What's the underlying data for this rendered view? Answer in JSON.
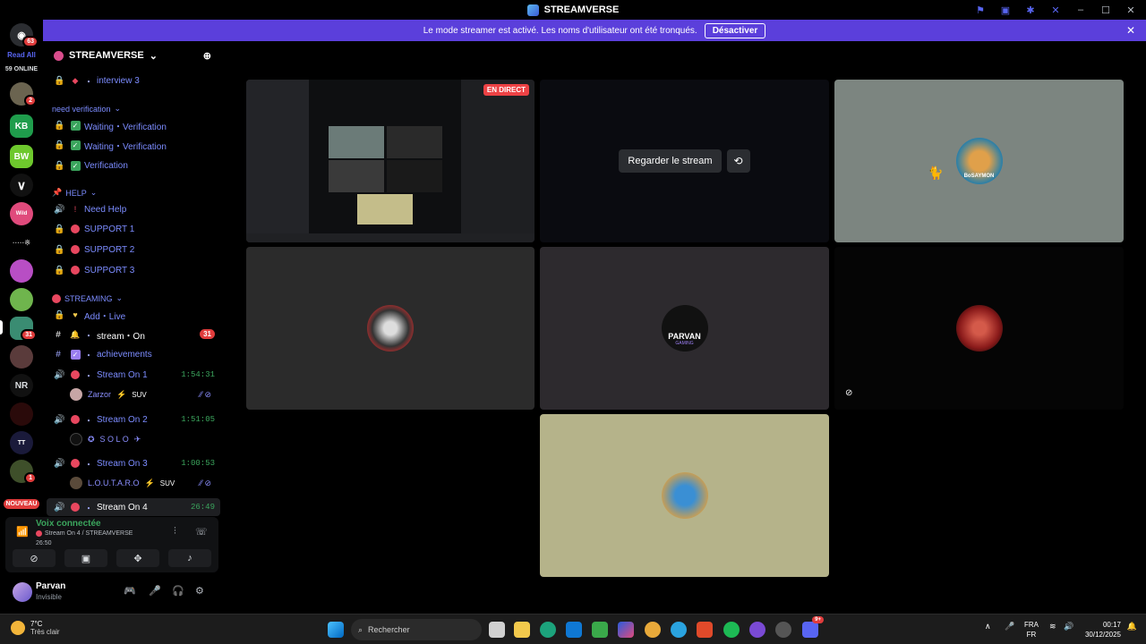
{
  "titlebar": {
    "app_name": "STREAMVERSE"
  },
  "banner": {
    "text": "Le mode streamer est activé. Les noms d'utilisateur ont été tronqués.",
    "button": "Désactiver"
  },
  "servers": {
    "dm_badge": "63",
    "read_all": "Read All",
    "online": "59 ONLINE",
    "badge_2": "2",
    "kb": "KB",
    "bw": "BW",
    "badge_31": "31",
    "nr": "NR",
    "badge_1": "1",
    "nouveau": "NOUVEAU"
  },
  "server_header": {
    "name": "STREAMVERSE"
  },
  "channels": {
    "interview3": "interview 3",
    "cat_need_verif": "need verification",
    "waiting1": "Waiting・Verification",
    "waiting2": "Waiting・Verification",
    "verification": "Verification",
    "cat_help": "HELP",
    "need_help": "Need Help",
    "support1": "SUPPORT 1",
    "support2": "SUPPORT 2",
    "support3": "SUPPORT 3",
    "cat_streaming": "STREAMING",
    "add_live": "Add・Live",
    "stream_on": "stream・On",
    "stream_on_badge": "31",
    "achievements": "achievements",
    "stream_on_1": "Stream On 1",
    "stream_on_1_time": "1:54:31",
    "user1": "Zarzor",
    "user1_tag": "SUV",
    "stream_on_2": "Stream On 2",
    "stream_on_2_time": "1:51:05",
    "user2": "S O L O",
    "stream_on_3": "Stream On 3",
    "stream_on_3_time": "1:00:53",
    "user3": "L.O.U.T.A.R.O",
    "user3_tag": "SUV",
    "stream_on_4": "Stream On 4",
    "stream_on_4_time": "26:49"
  },
  "voice": {
    "connected": "Voix connectée",
    "channel": "Stream On 4 / STREAMVERSE",
    "time": "26:50"
  },
  "user": {
    "name": "Parvan",
    "status": "Invisible"
  },
  "grid": {
    "live_label": "EN DIRECT",
    "watch_button": "Regarder le stream",
    "tile3_name": "BoSAYMON",
    "tile5_name": "PARVAN",
    "tile5_sub": "GAMING"
  },
  "taskbar": {
    "temp": "7°C",
    "weather": "Très clair",
    "search": "Rechercher",
    "lang1": "FRA",
    "lang2": "FR",
    "time": "00:17",
    "date": "30/12/2025",
    "badge": "9+"
  },
  "colors": {
    "accent": "#5865f2",
    "banner": "#5b3fdb",
    "live": "#ed4245",
    "green": "#3ba55d"
  }
}
